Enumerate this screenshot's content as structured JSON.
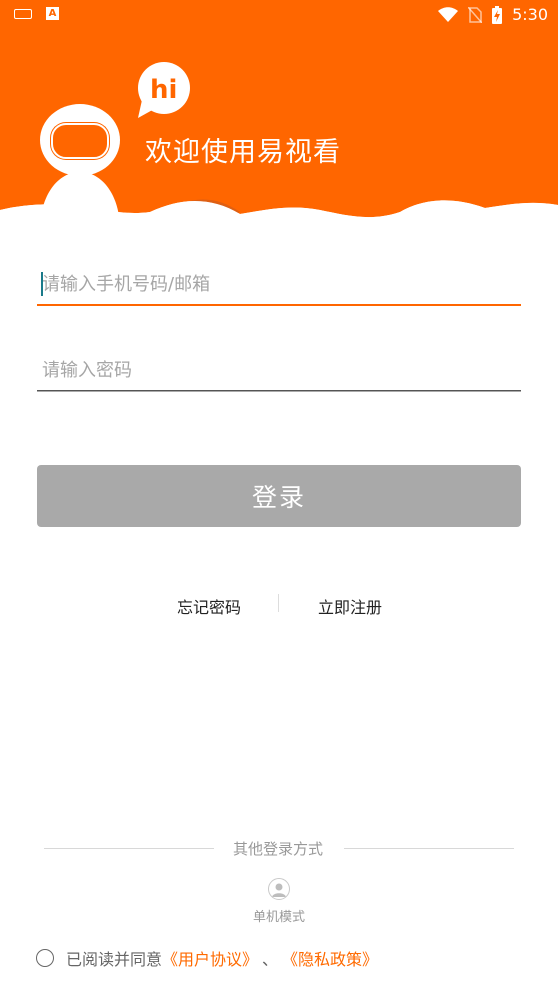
{
  "status_bar": {
    "time": "5:30",
    "icons": [
      "keyboard-icon",
      "notification-a-icon",
      "wifi-icon",
      "no-sim-icon",
      "battery-charging-icon"
    ]
  },
  "header": {
    "welcome_text": "欢迎使用易视看",
    "bubble_text": "hi",
    "brand_color": "#ff6600"
  },
  "form": {
    "account_placeholder": "请输入手机号码/邮箱",
    "account_value": "",
    "password_placeholder": "请输入密码",
    "password_value": "",
    "login_label": "登录"
  },
  "links": {
    "forgot_password": "忘记密码",
    "register_now": "立即注册"
  },
  "other_login": {
    "title": "其他登录方式",
    "offline_mode": "单机模式"
  },
  "agreement": {
    "prefix": "已阅读并同意",
    "user_agreement": "《用户协议》",
    "separator": "、",
    "privacy_policy": "《隐私政策》",
    "link_color": "#ff6a00"
  }
}
